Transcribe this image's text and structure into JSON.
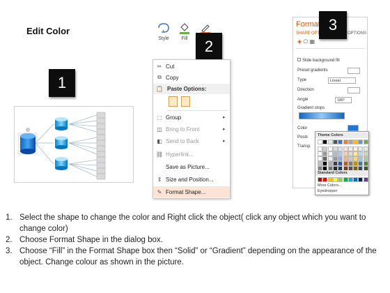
{
  "title": "Edit Color",
  "badges": [
    "1",
    "2",
    "3"
  ],
  "ribbon": {
    "buttons": [
      {
        "label": "Style",
        "icon": "shape-style-icon"
      },
      {
        "label": "Fill",
        "icon": "fill-bucket-icon"
      },
      {
        "label": "",
        "icon": "outline-pen-icon"
      }
    ],
    "colors": {
      "fill": "#70ad47",
      "outline": "#ed7d31"
    }
  },
  "context_menu": {
    "items": [
      {
        "icon": "scissors-icon",
        "label": "Cut",
        "disabled": false
      },
      {
        "icon": "copy-icon",
        "label": "Copy",
        "disabled": false
      },
      {
        "icon": "clipboard-icon",
        "label": "Paste Options:",
        "header": true
      },
      {
        "icon": "group-icon",
        "label": "Group",
        "submenu": true
      },
      {
        "icon": "bring-front-icon",
        "label": "Bring to Front",
        "submenu": true,
        "disabled": true
      },
      {
        "icon": "send-back-icon",
        "label": "Send to Back",
        "submenu": true,
        "disabled": true
      },
      {
        "icon": "hyperlink-icon",
        "label": "Hyperlink...",
        "disabled": true
      },
      {
        "icon": "picture-icon",
        "label": "Save as Picture..."
      },
      {
        "icon": "size-icon",
        "label": "Size and Position..."
      },
      {
        "icon": "format-shape-icon",
        "label": "Format Shape...",
        "highlighted": true
      }
    ]
  },
  "format_pane": {
    "title": "Format",
    "tab_left": "SHAPE OPT",
    "tab_right": "OPTIONS",
    "rows": [
      {
        "label": "Slide background fill"
      },
      {
        "label": "Preset gradients"
      },
      {
        "label": "Type",
        "value": "Linear"
      },
      {
        "label": "Direction"
      },
      {
        "label": "Angle",
        "value": "180°"
      },
      {
        "label": "Gradient stops"
      },
      {
        "label": "Color"
      },
      {
        "label": "Positi"
      },
      {
        "label": "Transp"
      }
    ],
    "palette": {
      "theme_header": "Theme Colors",
      "standard_header": "Standard Colors",
      "more_colors": "More Colors...",
      "eyedropper": "Eyedropper",
      "theme_colors": [
        "#ffffff",
        "#000000",
        "#e7e6e6",
        "#44546a",
        "#4472c4",
        "#ed7d31",
        "#a5a5a5",
        "#ffc000",
        "#5b9bd5",
        "#70ad47"
      ],
      "standard_colors": [
        "#c00000",
        "#ff0000",
        "#ffc000",
        "#ffff00",
        "#92d050",
        "#00b050",
        "#00b0f0",
        "#0070c0",
        "#002060",
        "#7030a0"
      ]
    }
  },
  "instructions": [
    {
      "num": "1.",
      "text": "Select the shape to change the color and Right click the object( click any object which you want to change color)"
    },
    {
      "num": "2.",
      "text": "Choose Format Shape in the dialog box."
    },
    {
      "num": "3.",
      "text": "Choose “Fill” in the Format Shape box then “Solid” or “Gradient” depending on the appearance of the object. Change colour as shown in the picture."
    }
  ]
}
